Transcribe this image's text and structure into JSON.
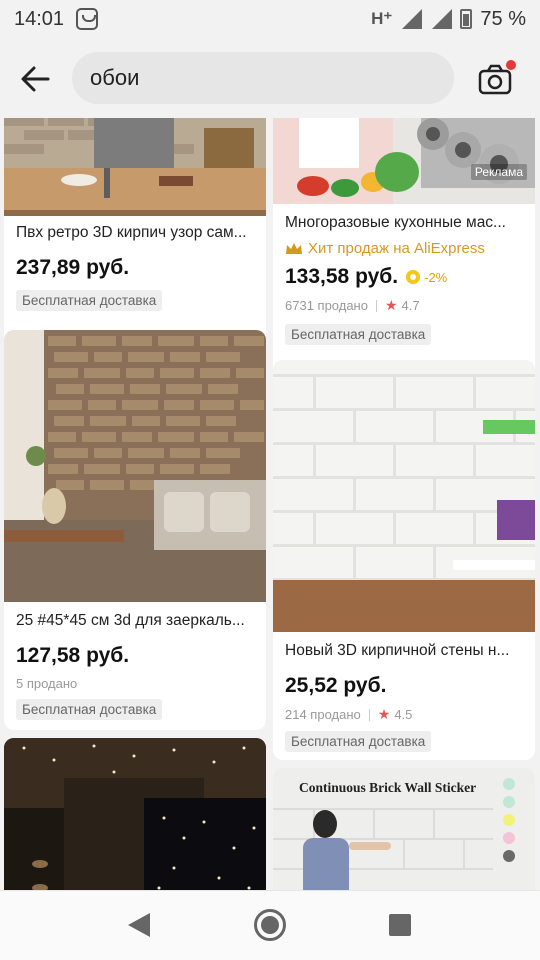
{
  "status_bar": {
    "time": "14:01",
    "network": "H⁺",
    "battery": "75 %"
  },
  "search": {
    "query": "обои"
  },
  "products": [
    {
      "title": "Пвх ретро 3D кирпич узор сам...",
      "price": "237,89 руб.",
      "shipping": "Бесплатная доставка",
      "image": "living-room-brick-wall"
    },
    {
      "title": "Многоразовые кухонные мас...",
      "badge": "Хит продаж на AliExpress",
      "price": "133,58 руб.",
      "discount": "-2%",
      "sold": "6731 продано",
      "rating": "4.7",
      "shipping": "Бесплатная доставка",
      "ad_label": "Реклама",
      "image": "kitchen-foil-rolls"
    },
    {
      "title": "25 #45*45 см 3d для заеркаль...",
      "price": "127,58 руб.",
      "sold": "5 продано",
      "shipping": "Бесплатная доставка",
      "image": "stone-brick-wallpaper"
    },
    {
      "title": "Новый 3D кирпичной стены н...",
      "price": "25,52 руб.",
      "sold": "214 продано",
      "rating": "4.5",
      "shipping": "Бесплатная доставка",
      "image": "white-brick-panels"
    },
    {
      "title": "",
      "image": "starry-ceiling-room"
    },
    {
      "title": "",
      "image_caption": "Continuous Brick Wall Sticker",
      "image": "brick-wall-sticker"
    }
  ],
  "colors": {
    "accent_gold": "#d49a1e",
    "rating_star": "#e85454",
    "notification_dot": "#e53935"
  }
}
